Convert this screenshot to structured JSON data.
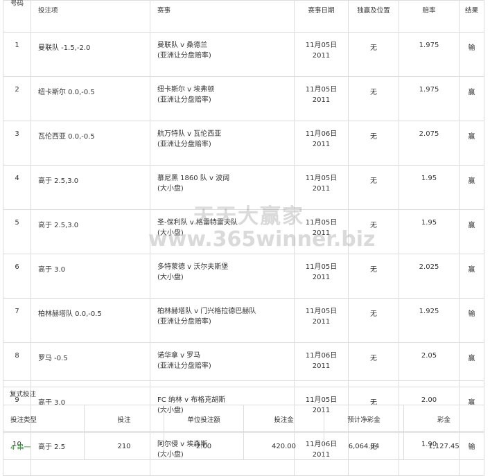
{
  "headers": {
    "num": "号码",
    "selection": "投注项",
    "event": "赛事",
    "date": "赛事日期",
    "position": "独赢及位置",
    "odds": "赔率",
    "result": "结果"
  },
  "rows": [
    {
      "num": "1",
      "selection": "曼联队 -1.5,-2.0",
      "event": "曼联队 v 桑德兰",
      "market": "(亚洲让分盘赔率)",
      "date": "11月05日",
      "year": "2011",
      "position": "无",
      "odds": "1.975",
      "result": "输"
    },
    {
      "num": "2",
      "selection": "纽卡斯尔 0.0,-0.5",
      "event": "纽卡斯尔 v 埃弗顿",
      "market": "(亚洲让分盘赔率)",
      "date": "11月05日",
      "year": "2011",
      "position": "无",
      "odds": "1.975",
      "result": "赢"
    },
    {
      "num": "3",
      "selection": "瓦伦西亚 0.0,-0.5",
      "event": "航万特队 v 瓦伦西亚",
      "market": "(亚洲让分盘赔率)",
      "date": "11月06日",
      "year": "2011",
      "position": "无",
      "odds": "2.075",
      "result": "赢"
    },
    {
      "num": "4",
      "selection": "高于 2.5,3.0",
      "event": "慕尼黑 1860 队 v 波阔",
      "market": "(大小盘)",
      "date": "11月05日",
      "year": "2011",
      "position": "无",
      "odds": "1.95",
      "result": "赢"
    },
    {
      "num": "5",
      "selection": "高于 2.5,3.0",
      "event": "圣-保利队 v 格雷特雷夫队",
      "market": "(大小盘)",
      "date": "11月05日",
      "year": "2011",
      "position": "无",
      "odds": "1.95",
      "result": "赢"
    },
    {
      "num": "6",
      "selection": "高于 3.0",
      "event": "多特蒙德 v 沃尔夫斯堡",
      "market": "(大小盘)",
      "date": "11月05日",
      "year": "2011",
      "position": "无",
      "odds": "2.025",
      "result": "赢"
    },
    {
      "num": "7",
      "selection": "柏林赫塔队 0.0,-0.5",
      "event": "柏林赫塔队 v 门兴格拉德巴赫队",
      "market": "(亚洲让分盘赔率)",
      "date": "11月05日",
      "year": "2011",
      "position": "无",
      "odds": "1.925",
      "result": "输"
    },
    {
      "num": "8",
      "selection": "罗马 -0.5",
      "event": "诺华拿 v 罗马",
      "market": "(亚洲让分盘赔率)",
      "date": "11月06日",
      "year": "2011",
      "position": "无",
      "odds": "2.05",
      "result": "赢"
    },
    {
      "num": "9",
      "selection": "高于 3.0",
      "event": "FC 纳林 v 布格克胡斯",
      "market": "(大小盘)",
      "date": "11月05日",
      "year": "2011",
      "position": "无",
      "odds": "2.00",
      "result": "赢"
    },
    {
      "num": "10",
      "selection": "高于 2.5",
      "event": "阿尔侵 v 埃森斯",
      "market": "(大小盘)",
      "date": "11月06日",
      "year": "2011",
      "position": "无",
      "odds": "1.90",
      "result": "输"
    }
  ],
  "combo_section_title": "复式投注",
  "combo_headers": {
    "type": "投注类型",
    "bets": "投注",
    "unit": "单位投注额",
    "stake": "投注金",
    "est_payout": "预计净彩金",
    "payout": "彩金"
  },
  "combo_row": {
    "type": "4 串一",
    "bets": "210",
    "unit": "2.00",
    "stake": "420.00",
    "est_payout": "6,064.84",
    "payout": "1,127.45"
  },
  "watermark": {
    "line1": "天天大赢家",
    "line2": "www.365winner.biz"
  }
}
